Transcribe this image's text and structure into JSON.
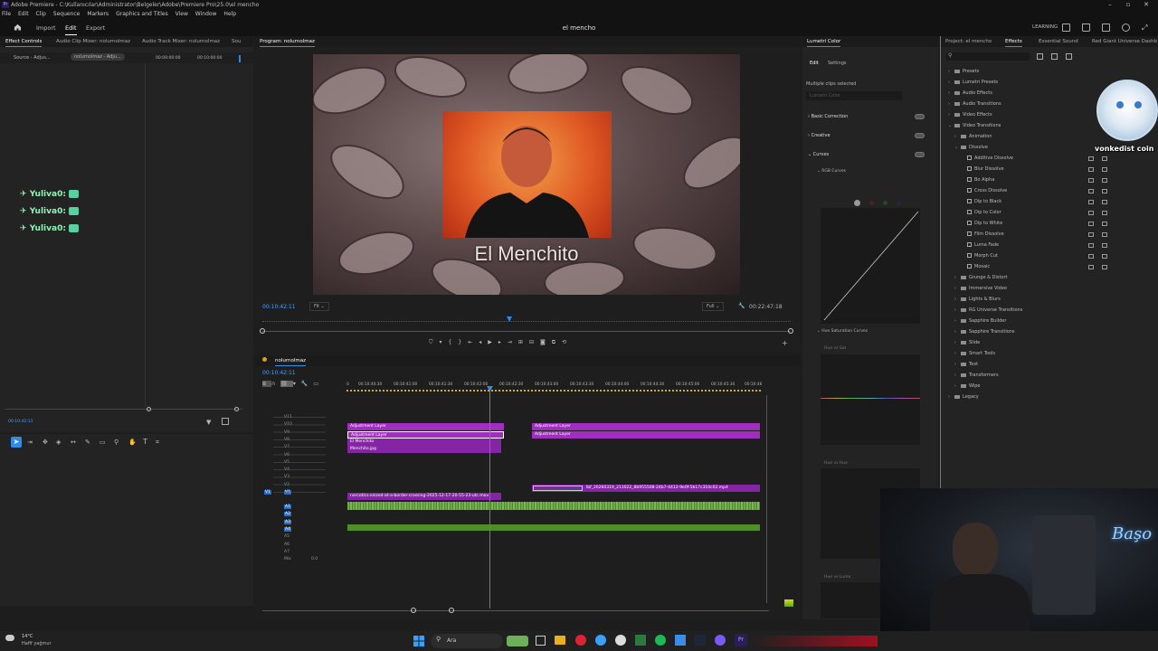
{
  "app": {
    "title": "Adobe Premiere - C:\\Kullanıcılar\\Administrator\\Belgeler\\Adobe\\Premiere Pro\\25.0\\el mencho",
    "icon_text": "Pr"
  },
  "menu": [
    "File",
    "Edit",
    "Clip",
    "Sequence",
    "Markers",
    "Graphics and Titles",
    "View",
    "Window",
    "Help"
  ],
  "header": {
    "tabs": [
      "Import",
      "Edit",
      "Export"
    ],
    "active_tab": "Edit",
    "doc_title": "el mencho",
    "learning": "LEARNING"
  },
  "effect_controls": {
    "tabs": [
      "Effect Controls",
      "Audio Clip Mixer: nolurnolmaz",
      "Audio Track Mixer: nolurnolmaz",
      "Sou"
    ],
    "source_label": "Source - Adjus...",
    "seq_label": "nolurnolmaz - Adju...",
    "time_a": "00:09:00:00",
    "time_b": "00:10:00:00",
    "chat": [
      {
        "user": "Yuliva0:"
      },
      {
        "user": "Yuliva0:"
      },
      {
        "user": "Yuliva0:"
      }
    ],
    "timecode": "00:10:42:11"
  },
  "program": {
    "tab": "Program: nolurnolmaz",
    "overlay_text": "El Menchito",
    "timecode": "00:10:42:11",
    "fit": "Fit",
    "quality": "Full",
    "duration": "00:22:47:18"
  },
  "timeline": {
    "tab": "nolurnolmaz",
    "timecode": "00:10:42:11",
    "ruler": [
      "00:10:40:30",
      "00:10:41:00",
      "00:10:41:30",
      "00:10:42:00",
      "00:10:42:30",
      "00:10:43:00",
      "00:10:43:30",
      "00:10:44:00",
      "00:10:44:30",
      "00:10:45:00",
      "00:10:45:30",
      "00:10:46"
    ],
    "video_tracks": [
      "V11",
      "V10",
      "V9",
      "V8",
      "V7",
      "V6",
      "V5",
      "V4",
      "V3",
      "V2",
      "V1"
    ],
    "audio_tracks": [
      "A1",
      "A2",
      "A3",
      "A4",
      "A5",
      "A6",
      "A7"
    ],
    "mix_label": "Mix",
    "mix_value": "0.0",
    "clips": {
      "v10_a": "Adjustment Layer",
      "v9_a": "Adjustment Layer",
      "v8_a": "El Menchito",
      "v7_a": "Menchito.jpg",
      "v10_b": "Adjustment Layer",
      "v9_b": "Adjustment Layer",
      "v2": "lbf_20260319_211022_8b955508-24b7-4412-9e0f-5b17c310c02.mp4",
      "v1": "narcotics-seized-at-a-border-crossing-2025-12-17-20-55-23-utc.mov",
      "fx": "fx"
    }
  },
  "lumetri": {
    "title": "Lumetri Color",
    "tabs": [
      "Edit",
      "Settings"
    ],
    "multiple": "Multiple clips selected",
    "dropdown": "Lumetri Color",
    "sections": [
      "Basic Correction",
      "Creative",
      "Curves"
    ],
    "rgb_curves": "RGB Curves",
    "hue_sat": "Hue Saturation Curves",
    "hue_vs_sat": "Hue vs Sat",
    "hue_vs_hue": "Hue vs Hue",
    "hue_vs_luma": "Hue vs Luma"
  },
  "effects": {
    "tabs": [
      "Project: el mencho",
      "Effects",
      "Essential Sound",
      "Red Giant Universe Dashb"
    ],
    "tree": [
      {
        "label": "Presets",
        "level": 0,
        "kind": "folder"
      },
      {
        "label": "Lumetri Presets",
        "level": 0,
        "kind": "folder"
      },
      {
        "label": "Audio Effects",
        "level": 0,
        "kind": "folder"
      },
      {
        "label": "Audio Transitions",
        "level": 0,
        "kind": "folder"
      },
      {
        "label": "Video Effects",
        "level": 0,
        "kind": "folder"
      },
      {
        "label": "Video Transitions",
        "level": 0,
        "kind": "folder",
        "open": true
      },
      {
        "label": "Animation",
        "level": 1,
        "kind": "folder"
      },
      {
        "label": "Dissolve",
        "level": 1,
        "kind": "folder",
        "open": true
      },
      {
        "label": "Additive Dissolve",
        "level": 2,
        "kind": "fx"
      },
      {
        "label": "Blur Dissolve",
        "level": 2,
        "kind": "fx"
      },
      {
        "label": "Bo Alpha",
        "level": 2,
        "kind": "fx"
      },
      {
        "label": "Cross Dissolve",
        "level": 2,
        "kind": "fx"
      },
      {
        "label": "Dip to Black",
        "level": 2,
        "kind": "fx"
      },
      {
        "label": "Dip to Color",
        "level": 2,
        "kind": "fx"
      },
      {
        "label": "Dip to White",
        "level": 2,
        "kind": "fx"
      },
      {
        "label": "Film Dissolve",
        "level": 2,
        "kind": "fx"
      },
      {
        "label": "Luma Fade",
        "level": 2,
        "kind": "fx"
      },
      {
        "label": "Morph Cut",
        "level": 2,
        "kind": "fx"
      },
      {
        "label": "Mosaic",
        "level": 2,
        "kind": "fx"
      },
      {
        "label": "Grunge & Distort",
        "level": 1,
        "kind": "folder"
      },
      {
        "label": "Immersive Video",
        "level": 1,
        "kind": "folder"
      },
      {
        "label": "Lights & Blurs",
        "level": 1,
        "kind": "folder"
      },
      {
        "label": "RG Universe Transitions",
        "level": 1,
        "kind": "folder"
      },
      {
        "label": "Sapphire Builder",
        "level": 1,
        "kind": "folder"
      },
      {
        "label": "Sapphire Transitions",
        "level": 1,
        "kind": "folder"
      },
      {
        "label": "Slide",
        "level": 1,
        "kind": "folder"
      },
      {
        "label": "Smart Tools",
        "level": 1,
        "kind": "folder"
      },
      {
        "label": "Text",
        "level": 1,
        "kind": "folder"
      },
      {
        "label": "Transformers",
        "level": 1,
        "kind": "folder"
      },
      {
        "label": "Wipe",
        "level": 1,
        "kind": "folder"
      },
      {
        "label": "Legacy",
        "level": 0,
        "kind": "folder"
      }
    ],
    "sticker_text": "vonkedist coin"
  },
  "webcam": {
    "neon_text": "Başo"
  },
  "taskbar": {
    "weather_temp": "14°C",
    "weather_desc": "Hafif yağmur",
    "search": "Ara"
  },
  "colors": {
    "accent_blue": "#2d8ceb",
    "clip_purple": "#a02fbf",
    "audio_green": "#4f8c2a",
    "timeline_bg": "#1e1e1e"
  }
}
